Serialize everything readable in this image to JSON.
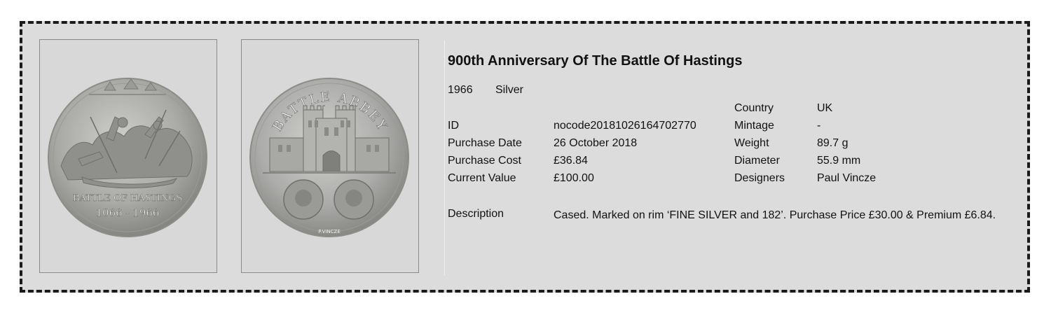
{
  "title": "900th Anniversary Of The Battle Of Hastings",
  "year": "1966",
  "metal": "Silver",
  "left_fields": {
    "id_label": "ID",
    "id_value": "nocode20181026164702770",
    "purchase_date_label": "Purchase Date",
    "purchase_date_value": "26 October 2018",
    "purchase_cost_label": "Purchase Cost",
    "purchase_cost_value": "£36.84",
    "current_value_label": "Current Value",
    "current_value_value": "£100.00"
  },
  "right_fields": {
    "country_label": "Country",
    "country_value": "UK",
    "mintage_label": "Mintage",
    "mintage_value": "-",
    "weight_label": "Weight",
    "weight_value": "89.7 g",
    "diameter_label": "Diameter",
    "diameter_value": "55.9 mm",
    "designers_label": "Designers",
    "designers_value": "Paul Vincze"
  },
  "description_label": "Description",
  "description_value": "Cased.  Marked on rim ‘FINE SILVER and 182’.  Purchase Price £30.00 & Premium £6.84.",
  "images": {
    "obverse": {
      "legend_line1": "BATTLE OF HASTINGS",
      "legend_line2": "1066 - 1966"
    },
    "reverse": {
      "legend": "BATTLE ABBEY",
      "signature": "P.VINCZE"
    }
  }
}
